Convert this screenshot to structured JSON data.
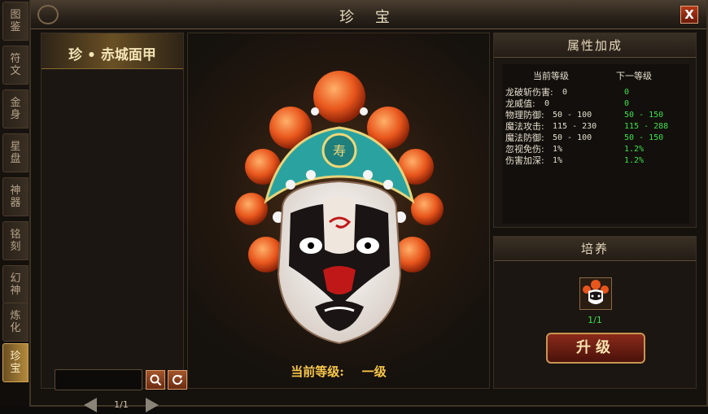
{
  "side_tabs": [
    "图鉴",
    "符文",
    "金身",
    "星盘",
    "神器",
    "铭刻",
    "幻神",
    "炼化",
    "珍宝"
  ],
  "window": {
    "title": "珍 宝",
    "close_label": "X"
  },
  "item_list": {
    "selected_name": "珍 • 赤城面甲",
    "page": "1/1"
  },
  "center": {
    "level_label": "当前等级:",
    "level_value": "一级"
  },
  "stats": {
    "title": "属性加成",
    "current_header": "当前等级",
    "next_header": "下一等级",
    "rows": [
      {
        "name": "龙破斩伤害:",
        "current": "0",
        "next": "0"
      },
      {
        "name": "龙威值:",
        "current": "0",
        "next": "0"
      },
      {
        "name": "物理防御:",
        "current": "50 - 100",
        "next": "50 - 150"
      },
      {
        "name": "魔法攻击:",
        "current": "115 - 230",
        "next": "115 - 288"
      },
      {
        "name": "魔法防御:",
        "current": "50 - 100",
        "next": "50 - 150"
      },
      {
        "name": "忽视免伤:",
        "current": "1%",
        "next": "1.2%"
      },
      {
        "name": "伤害加深:",
        "current": "1%",
        "next": "1.2%"
      }
    ]
  },
  "cultivate": {
    "title": "培养",
    "count": "1/1",
    "upgrade_label": "升级"
  },
  "colors": {
    "accent_gold": "#f7c64a",
    "next_value_green": "#3fe04a",
    "button_red": "#8a2a1a"
  }
}
